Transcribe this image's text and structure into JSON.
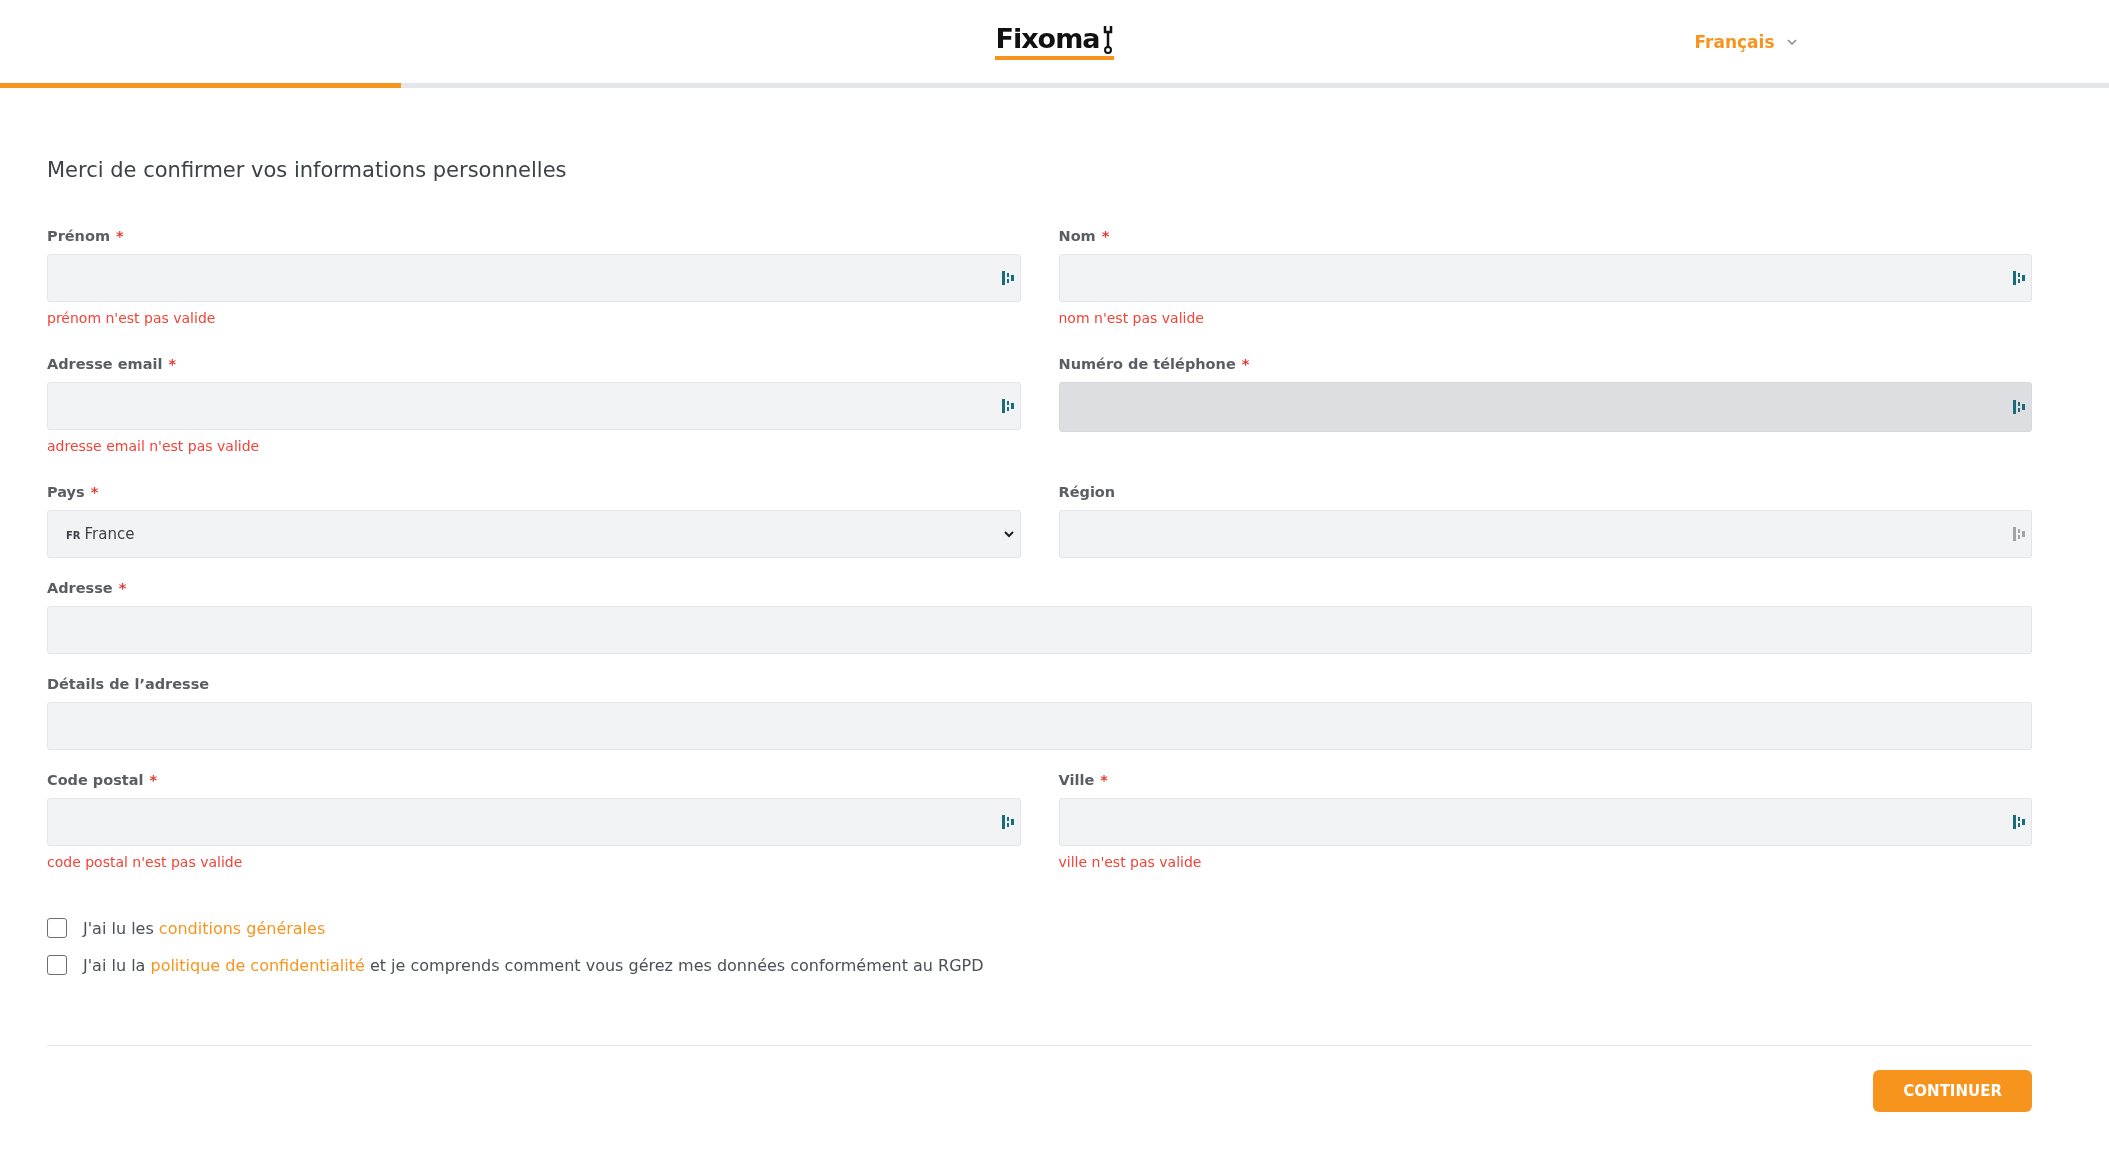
{
  "header": {
    "logo": "Fixoma",
    "language": "Français"
  },
  "progress": {
    "level": 0.19
  },
  "title": "Merci de confirmer vos informations personnelles",
  "fields": [
    {
      "label": "Prénom",
      "required_mark": "*",
      "kind": "input",
      "full_width": false,
      "disabled": false,
      "helper_icon": true,
      "helper_dimmed": false,
      "error": "prénom n'est pas valide"
    },
    {
      "label": "Nom",
      "required_mark": "*",
      "kind": "input",
      "full_width": false,
      "disabled": false,
      "helper_icon": true,
      "helper_dimmed": false,
      "error": "nom n'est pas valide"
    },
    {
      "label": "Adresse email",
      "required_mark": "*",
      "kind": "input",
      "full_width": false,
      "disabled": false,
      "helper_icon": true,
      "helper_dimmed": false,
      "error": "adresse email n'est pas valide"
    },
    {
      "label": "Numéro de téléphone",
      "required_mark": "*",
      "kind": "input",
      "full_width": false,
      "disabled": true,
      "helper_icon": true,
      "helper_dimmed": false
    },
    {
      "label": "Pays",
      "required_mark": "*",
      "kind": "select",
      "full_width": false,
      "disabled": false,
      "prefix": "FR",
      "value": "France"
    },
    {
      "label": "Région",
      "kind": "input",
      "full_width": false,
      "disabled": false,
      "helper_icon": true,
      "helper_dimmed": true
    },
    {
      "label": "Adresse",
      "required_mark": "*",
      "kind": "input",
      "full_width": true,
      "disabled": false
    },
    {
      "label": "Détails de l’adresse",
      "kind": "input",
      "full_width": true,
      "disabled": false
    },
    {
      "label": "Code postal",
      "required_mark": "*",
      "kind": "input",
      "full_width": false,
      "disabled": false,
      "helper_icon": true,
      "helper_dimmed": false,
      "error": "code postal n'est pas valide"
    },
    {
      "label": "Ville",
      "required_mark": "*",
      "kind": "input",
      "full_width": false,
      "disabled": false,
      "helper_icon": true,
      "helper_dimmed": false,
      "error": "ville n'est pas valide"
    }
  ],
  "agreements": [
    {
      "checked": false,
      "before": "J'ai lu les ",
      "link": "conditions générales"
    },
    {
      "checked": false,
      "before": "J'ai lu la ",
      "link": "politique de confidentialité",
      "after": " et je comprends comment vous gérez mes données conformément au RGPD"
    }
  ],
  "continue_button": "CONTINUER"
}
